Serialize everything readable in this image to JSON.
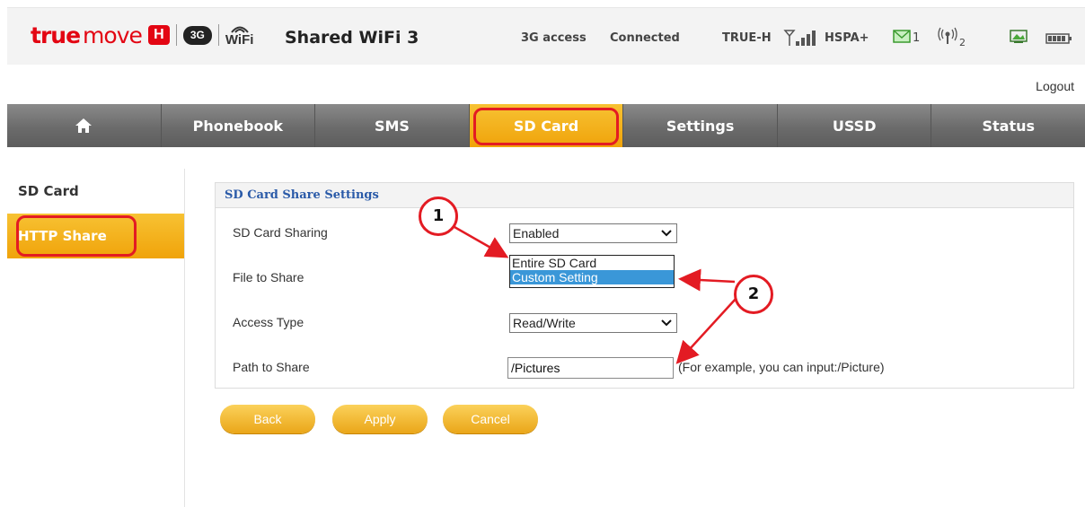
{
  "header": {
    "brand_true": "true",
    "brand_move": "move",
    "brand_h": "H",
    "badge_3g": "3G",
    "wifi_text": "WiFi",
    "device_name": "Shared WiFi 3",
    "access": "3G access",
    "connection": "Connected",
    "carrier": "TRUE-H",
    "network_type": "HSPA+",
    "sms_count": "1",
    "clients_count": "2"
  },
  "logout_label": "Logout",
  "nav": {
    "items": [
      {
        "label": ""
      },
      {
        "label": "Phonebook"
      },
      {
        "label": "SMS"
      },
      {
        "label": "SD Card"
      },
      {
        "label": "Settings"
      },
      {
        "label": "USSD"
      },
      {
        "label": "Status"
      }
    ]
  },
  "sidebar": {
    "items": [
      {
        "label": "SD Card"
      },
      {
        "label": "HTTP Share"
      }
    ]
  },
  "panel": {
    "title": "SD Card Share Settings",
    "sharing_label": "SD Card Sharing",
    "sharing_value": "Enabled",
    "file_label": "File to Share",
    "file_options": [
      "Entire SD Card",
      "Custom Setting"
    ],
    "access_label": "Access Type",
    "access_value": "Read/Write",
    "path_label": "Path to Share",
    "path_value": "/Pictures",
    "path_hint": "(For example, you can input:/Picture)"
  },
  "buttons": {
    "back": "Back",
    "apply": "Apply",
    "cancel": "Cancel"
  },
  "annotations": [
    "1",
    "2"
  ],
  "colors": {
    "accent": "#f0a30a",
    "highlight": "#e31b23",
    "title_blue": "#2a5aa8"
  }
}
